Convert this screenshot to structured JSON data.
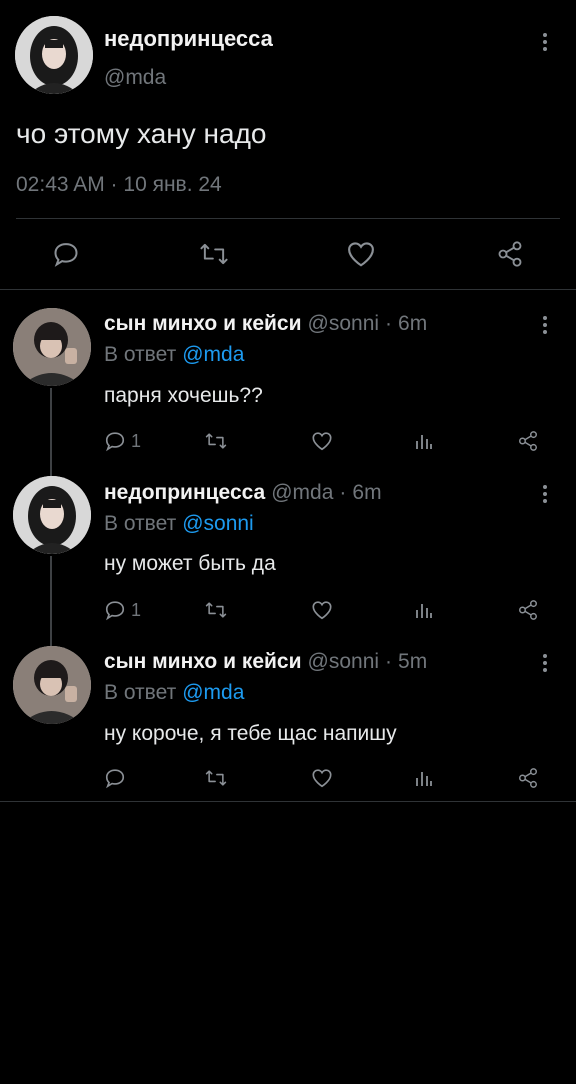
{
  "main_tweet": {
    "author_name": "недопринцесса",
    "author_handle": "@mda",
    "text": "чо этому хану надо",
    "timestamp": "02:43 AM · 10 янв. 24",
    "icons": [
      "reply-icon",
      "retweet-icon",
      "like-icon",
      "share-icon"
    ]
  },
  "replies": [
    {
      "author_name": "сын минхо и кейси",
      "author_handle": "@sonni",
      "time": "6m",
      "reply_to_label": "В ответ",
      "reply_to": "@mda",
      "text": "парня хочешь??",
      "reply_count": "1"
    },
    {
      "author_name": "недопринцесса",
      "author_handle": "@mda",
      "time": "6m",
      "reply_to_label": "В ответ",
      "reply_to": "@sonni",
      "text": "ну может быть да",
      "reply_count": "1"
    },
    {
      "author_name": "сын минхо и кейси",
      "author_handle": "@sonni",
      "time": "5m",
      "reply_to_label": "В ответ",
      "reply_to": "@mda",
      "text": "ну короче, я тебе щас напишу",
      "reply_count": ""
    }
  ],
  "separator": "·",
  "colors": {
    "background": "#000000",
    "text": "#e7e9ea",
    "muted": "#71767b",
    "link": "#1d9bf0",
    "divider": "#2f3336"
  }
}
